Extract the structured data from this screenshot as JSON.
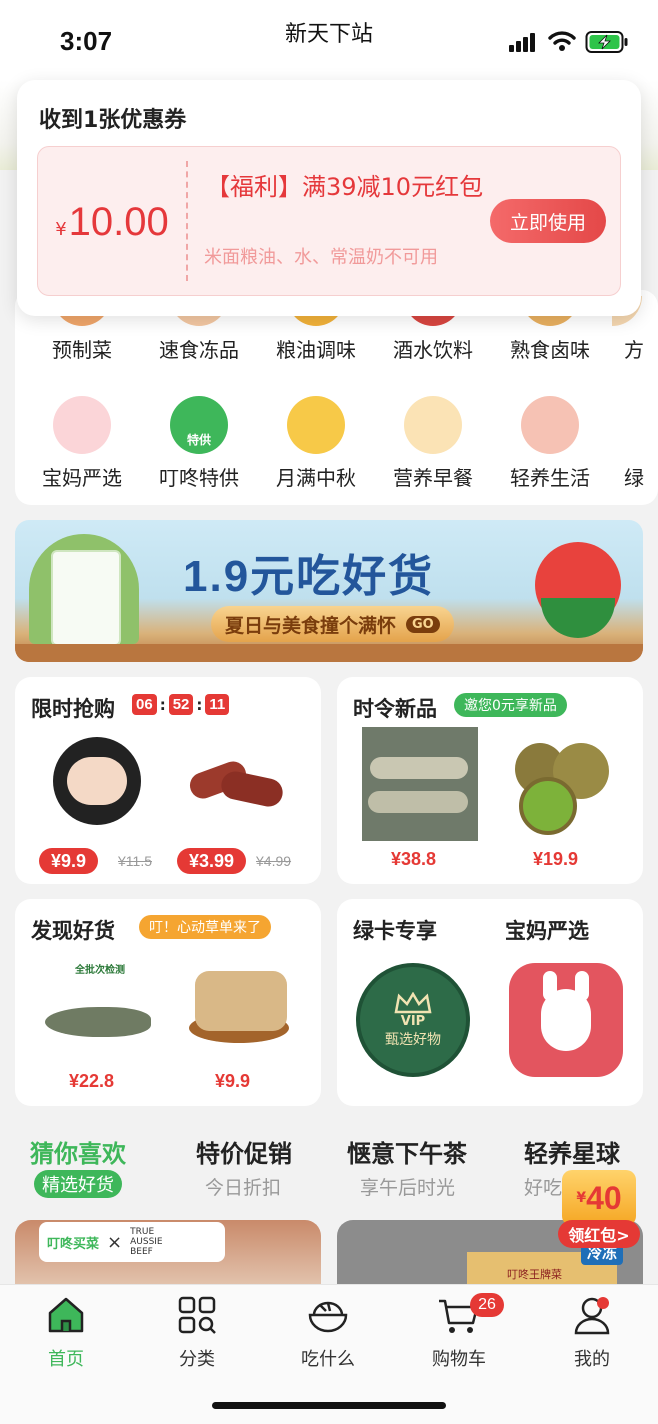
{
  "status_bar": {
    "time": "3:07",
    "app_title": "新天下站"
  },
  "coupon_popup": {
    "title": "收到1张优惠券",
    "currency": "¥",
    "amount": "10.00",
    "name": "【福利】满39减10元红包",
    "note": "米面粮油、水、常温奶不可用",
    "button": "立即使用"
  },
  "categories": {
    "row1": [
      "预制菜",
      "速食冻品",
      "粮油调味",
      "酒水饮料",
      "熟食卤味",
      "方"
    ],
    "row2": [
      "宝妈严选",
      "叮咚特供",
      "月满中秋",
      "营养早餐",
      "轻养生活",
      "绿"
    ],
    "badge_tegong": "特供"
  },
  "banner": {
    "title": "1.9元吃好货",
    "subtitle": "夏日与美食撞个满怀",
    "go": "GO"
  },
  "flash_sale": {
    "title": "限时抢购",
    "countdown": [
      "06",
      "52",
      "11"
    ],
    "sep": ":",
    "items": [
      {
        "price": "¥9.9",
        "old": "¥11.5"
      },
      {
        "price": "¥3.99",
        "old": "¥4.99"
      }
    ]
  },
  "new_products": {
    "title": "时令新品",
    "tag": "邀您0元享新品",
    "items": [
      {
        "price": "¥38.8"
      },
      {
        "price": "¥19.9"
      }
    ]
  },
  "discover": {
    "title": "发现好货",
    "tag": "叮！心动草单来了",
    "items": [
      {
        "price": "¥22.8"
      },
      {
        "price": "¥9.9"
      }
    ],
    "fish_label": "全批次检测"
  },
  "green_card": {
    "title": "绿卡专享",
    "vip_text": "VIP",
    "vip_sub": "甄选好物"
  },
  "mom_select": {
    "title": "宝妈严选"
  },
  "feed_tabs": [
    {
      "title": "猜你喜欢",
      "sub": "精选好货"
    },
    {
      "title": "特价促销",
      "sub": "今日折扣"
    },
    {
      "title": "惬意下午茶",
      "sub": "享午后时光"
    },
    {
      "title": "轻养星球",
      "sub": "好吃"
    }
  ],
  "feed_cards": {
    "brand": "叮咚买菜",
    "times": "×",
    "partner": "TRUE AUSSIE BEEF",
    "frozen": "冷冻",
    "box": "叮咚王牌菜"
  },
  "float_red_packet": {
    "amount": "40",
    "currency": "¥",
    "label": "领红包>"
  },
  "tab_bar": {
    "items": [
      "首页",
      "分类",
      "吃什么",
      "购物车",
      "我的"
    ],
    "cart_badge": "26"
  },
  "colors": {
    "brand_green": "#3eb75a",
    "red": "#e53935",
    "orange": "#f5a531"
  }
}
